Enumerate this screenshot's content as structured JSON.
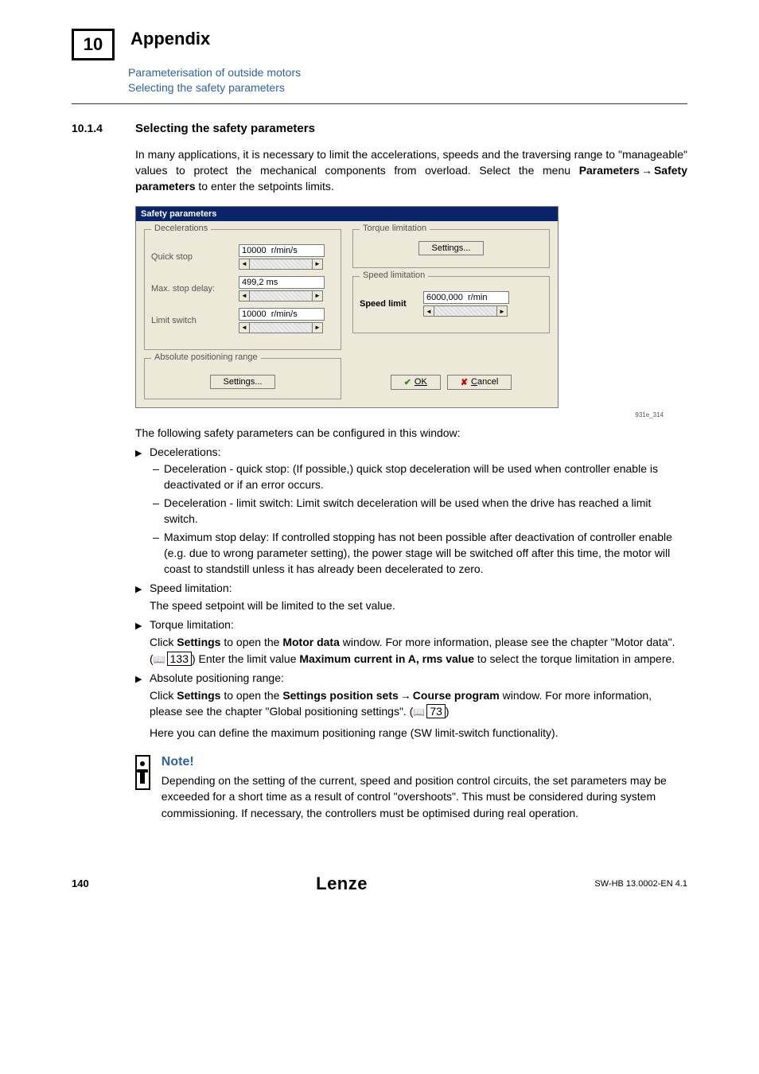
{
  "chapter": {
    "num": "10",
    "title": "Appendix",
    "sub1": "Parameterisation of outside motors",
    "sub2": "Selecting the safety parameters"
  },
  "section": {
    "num": "10.1.4",
    "title": "Selecting the safety parameters"
  },
  "intro": {
    "p1a": "In many applications, it is necessary to limit the accelerations, speeds and the traversing range to \"manageable\" values to protect the mechanical components from overload. Select the menu ",
    "b1": "Parameters",
    "b2": "Safety parameters",
    "p1b": " to enter the setpoints limits."
  },
  "dialog": {
    "title": "Safety parameters",
    "grp_decel": "Decelerations",
    "lbl_quickstop": "Quick stop",
    "val_quickstop": "10000  r/min/s",
    "lbl_maxdelay": "Max. stop delay:",
    "val_maxdelay": "499,2 ms",
    "lbl_limitswitch": "Limit switch",
    "val_limitswitch": "10000  r/min/s",
    "grp_abs": "Absolute positioning range",
    "btn_settings": "Settings...",
    "grp_torque": "Torque limitation",
    "grp_speed": "Speed limitation",
    "lbl_speedlimit": "Speed limit",
    "val_speedlimit": "6000,000  r/min",
    "btn_ok": "OK",
    "btn_cancel": "Cancel"
  },
  "figref": "931e_314",
  "after_dlg": "The following safety parameters can be configured in this window:",
  "list": {
    "decel_title": "Decelerations:",
    "decel_a": "Deceleration - quick stop: (If possible,) quick stop deceleration will be used when controller enable is deactivated or if an error occurs.",
    "decel_b": "Deceleration - limit switch: Limit switch deceleration will be used when the drive has reached a limit switch.",
    "decel_c": "Maximum stop delay: If controlled stopping has not been possible after deactivation of controller enable (e.g. due to wrong parameter setting), the power stage will be switched off after this time, the motor will coast to standstill unless it has already been decelerated to zero.",
    "speed_title": "Speed limitation:",
    "speed_body": "The speed setpoint will be limited to the set value.",
    "torque_title": "Torque limitation:",
    "torque_a": "Click ",
    "torque_b1": "Settings",
    "torque_c": " to open the ",
    "torque_b2": "Motor data",
    "torque_d": " window. For more information, please see the chapter \"Motor data\". (",
    "torque_ref": "133",
    "torque_e": ") Enter the limit value ",
    "torque_b3": "Maximum current in A, rms value",
    "torque_f": " to select the torque limitation in ampere.",
    "abs_title": "Absolute positioning range:",
    "abs_a": "Click ",
    "abs_b1": "Settings",
    "abs_c": " to open the ",
    "abs_b2": "Settings position sets",
    "abs_b3": "Course program",
    "abs_d": " window. For more information, please see the chapter \"Global positioning settings\". (",
    "abs_ref": "73",
    "abs_e": ")",
    "abs_body2": "Here you can define the maximum positioning range (SW limit-switch functionality)."
  },
  "note": {
    "title": "Note!",
    "body": "Depending on the setting of the current, speed and position control circuits, the set parameters may be exceeded for a short time as a result of control \"overshoots\". This must be considered during system commissioning. If necessary, the controllers must be optimised during real operation."
  },
  "footer": {
    "page": "140",
    "logo": "Lenze",
    "doc": "SW-HB 13.0002-EN   4.1"
  }
}
